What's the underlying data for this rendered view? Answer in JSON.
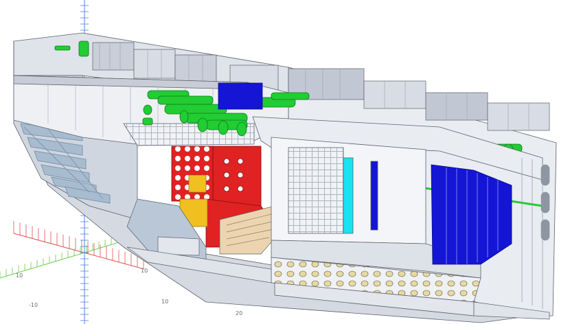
{
  "viewport": {
    "background": "#ffffff",
    "colors": {
      "hull_plate": "#e9ecf1",
      "hull_plate_dark": "#c7ccd6",
      "hull_edge": "#5a5f6b",
      "frame_bluegrey": "#a8bccf",
      "piping_green": "#22cc33",
      "blue_block": "#1515d6",
      "red_panel": "#e02222",
      "yellow_part": "#f0c020",
      "cyan_plate": "#17e4f0",
      "axis_red": "#e05050",
      "axis_green": "#66cc44",
      "axis_blue": "#4f86d8"
    },
    "icons": [
      "ship-hull-3d-model",
      "coordinate-axis-rulers"
    ]
  },
  "axes": {
    "tick_labels": [
      {
        "id": "axis-label-10-upper",
        "text": "10"
      },
      {
        "id": "axis-label-10-left",
        "text": "10"
      },
      {
        "id": "axis-label-neg10",
        "text": "-10"
      },
      {
        "id": "axis-label-10-lower",
        "text": "10"
      },
      {
        "id": "axis-label-20",
        "text": "20"
      }
    ]
  }
}
